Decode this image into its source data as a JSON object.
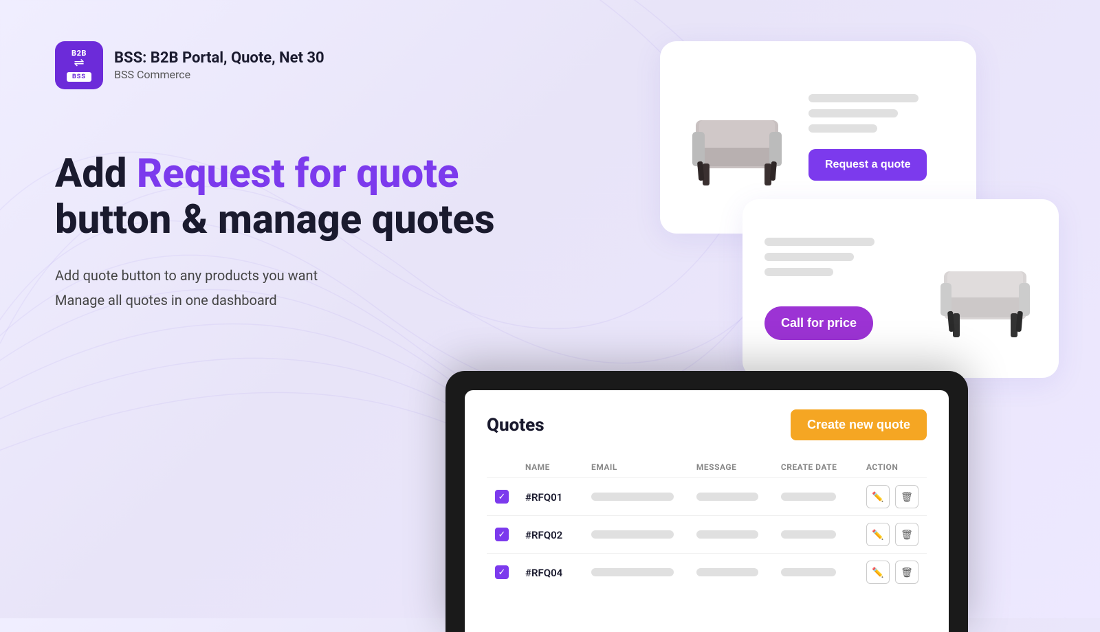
{
  "app": {
    "logo_bg": "#6c2bd9",
    "logo_b2b": "B2B",
    "logo_bss": "BSS",
    "title": "BSS: B2B Portal, Quote, Net 30",
    "subtitle": "BSS Commerce"
  },
  "hero": {
    "line1_plain": "Add ",
    "line1_highlight": "Request for quote",
    "line2": "button & manage quotes",
    "point1": "Add quote button to any products you want",
    "point2": "Manage all quotes in one dashboard"
  },
  "card_request": {
    "button_label": "Request a quote"
  },
  "card_call": {
    "button_label": "Call for price"
  },
  "dashboard": {
    "title": "Quotes",
    "create_button": "Create new quote",
    "table_headers": {
      "check": "",
      "name": "NAME",
      "email": "EMAIL",
      "message": "MESSAGE",
      "create_date": "CREATE DATE",
      "action": "ACTION"
    },
    "rows": [
      {
        "id": "#RFQ01"
      },
      {
        "id": "#RFQ02"
      },
      {
        "id": "#RFQ04"
      }
    ]
  },
  "colors": {
    "brand_purple": "#7c3aed",
    "brand_orange": "#f5a623",
    "call_purple": "#9c33d4"
  }
}
